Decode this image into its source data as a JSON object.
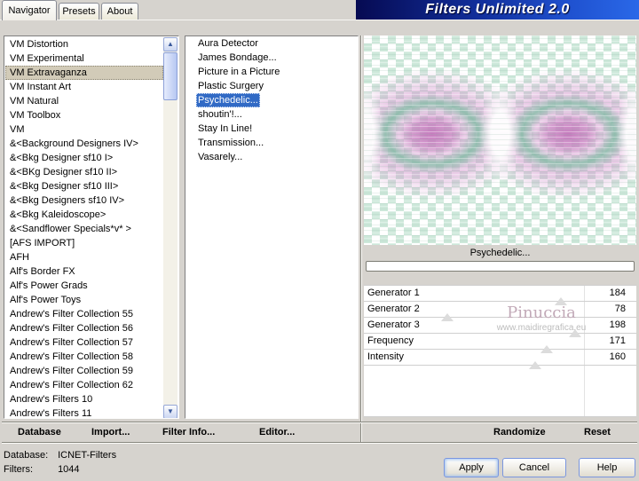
{
  "window": {
    "banner_title": "Filters Unlimited 2.0"
  },
  "colors": {
    "dialog_bg": "#d6d3ce",
    "selection_active": "#316ac5",
    "selection_inactive": "#d2cbb8",
    "banner_start": "#060a52",
    "banner_end": "#2a68e8"
  },
  "tabs": [
    {
      "label": "Navigator"
    },
    {
      "label": "Presets"
    },
    {
      "label": "About"
    }
  ],
  "categories": {
    "selected_index": 2,
    "items": [
      "VM Distortion",
      "VM Experimental",
      "VM Extravaganza",
      "VM Instant Art",
      "VM Natural",
      "VM Toolbox",
      "VM",
      "&<Background Designers IV>",
      "&<Bkg Designer sf10 I>",
      "&<BKg Designer sf10 II>",
      "&<Bkg Designer sf10 III>",
      "&<Bkg Designers sf10 IV>",
      "&<Bkg Kaleidoscope>",
      "&<Sandflower Specials*v* >",
      "[AFS IMPORT]",
      "AFH",
      "Alf's Border FX",
      "Alf's Power Grads",
      "Alf's Power Toys",
      "Andrew's Filter Collection 55",
      "Andrew's Filter Collection 56",
      "Andrew's Filter Collection 57",
      "Andrew's Filter Collection 58",
      "Andrew's Filter Collection 59",
      "Andrew's Filter Collection 62",
      "Andrew's Filters 10",
      "Andrew's Filters 11"
    ]
  },
  "filters": {
    "selected_index": 4,
    "items": [
      "Aura Detector",
      "James Bondage...",
      "Picture in a Picture",
      "Plastic Surgery",
      "Psychedelic...",
      "shoutin'!...",
      "Stay In Line!",
      "Transmission...",
      "Vasarely..."
    ]
  },
  "preview": {
    "caption": "Psychedelic..."
  },
  "params": {
    "max": 255,
    "items": [
      {
        "label": "Generator 1",
        "value": 184
      },
      {
        "label": "Generator 2",
        "value": 78
      },
      {
        "label": "Generator 3",
        "value": 198
      },
      {
        "label": "Frequency",
        "value": 171
      },
      {
        "label": "Intensity",
        "value": 160
      }
    ]
  },
  "watermark": {
    "name": "Pinuccia",
    "url": "www.maidiregrafica.eu"
  },
  "toolbar": {
    "database": "Database",
    "import": "Import...",
    "filter_info": "Filter Info...",
    "editor": "Editor...",
    "randomize": "Randomize",
    "reset": "Reset"
  },
  "status": {
    "database_label": "Database:",
    "database_value": "ICNET-Filters",
    "filters_label": "Filters:",
    "filters_value": "1044"
  },
  "buttons": {
    "apply": "Apply",
    "cancel": "Cancel",
    "help": "Help"
  },
  "scrollbar": {
    "up_glyph": "▲",
    "down_glyph": "▼"
  }
}
